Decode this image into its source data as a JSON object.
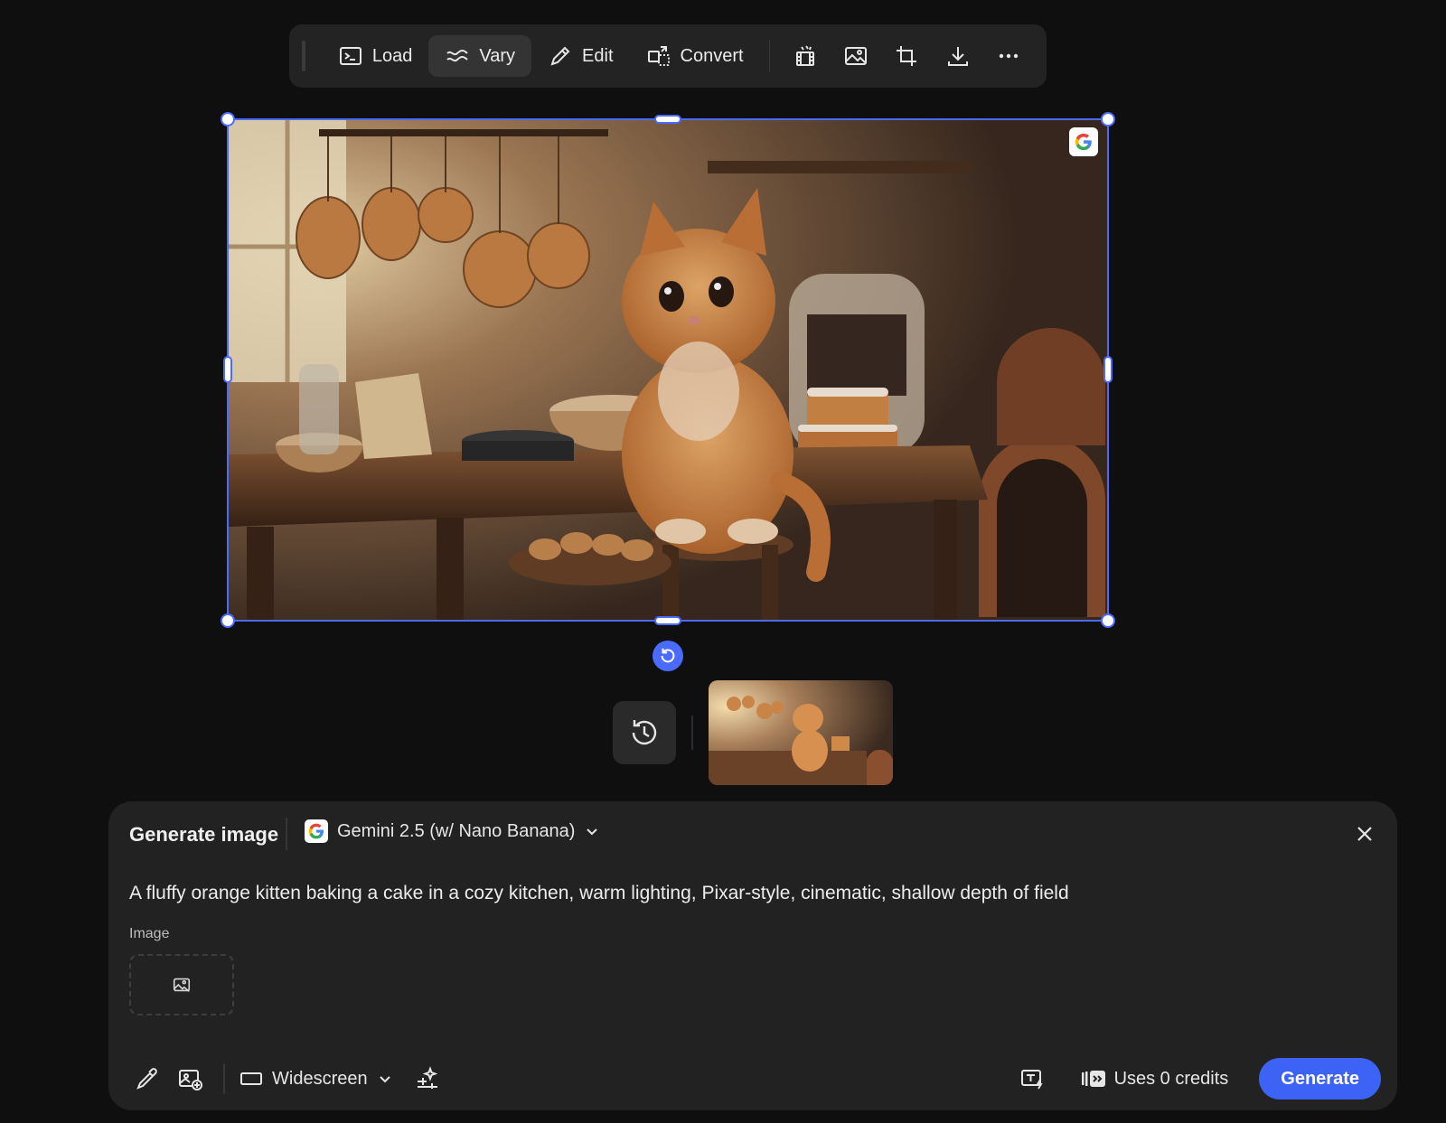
{
  "toolbar": {
    "load_label": "Load",
    "vary_label": "Vary",
    "edit_label": "Edit",
    "convert_label": "Convert",
    "icons": [
      "animate-icon",
      "image-icon",
      "crop-icon",
      "download-icon",
      "more-icon"
    ]
  },
  "canvas": {
    "badge_letter": "G"
  },
  "panel": {
    "title": "Generate image",
    "model_label": "Gemini 2.5 (w/ Nano Banana)",
    "prompt": "A fluffy orange kitten baking a cake in a cozy kitchen, warm lighting, Pixar-style, cinematic, shallow depth of field",
    "image_label": "Image",
    "aspect_ratio": "Widescreen",
    "credits_label": "Uses 0 credits",
    "generate_label": "Generate"
  },
  "colors": {
    "accent": "#3d63f6",
    "selection": "#4b6bff",
    "panel_bg": "#222222",
    "page_bg": "#0f0f10"
  }
}
